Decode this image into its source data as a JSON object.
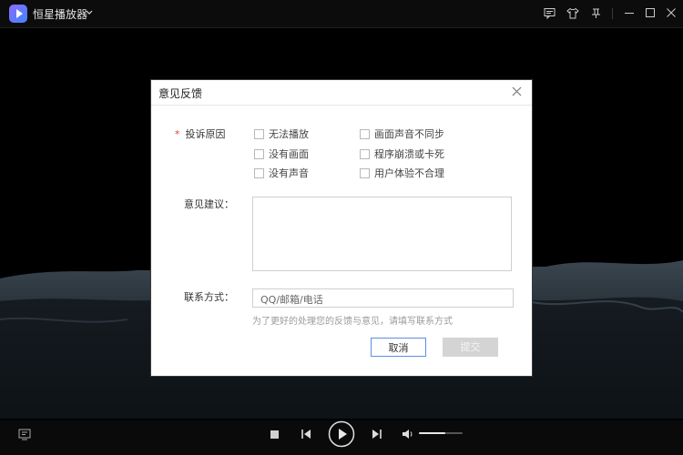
{
  "app": {
    "title": "恒星播放器"
  },
  "dialog": {
    "title": "意见反馈",
    "reason_label": "投诉原因",
    "required_mark": "*",
    "reasons": [
      {
        "label": "无法播放"
      },
      {
        "label": "画面声音不同步"
      },
      {
        "label": "没有画面"
      },
      {
        "label": "程序崩溃或卡死"
      },
      {
        "label": "没有声音"
      },
      {
        "label": "用户体验不合理"
      }
    ],
    "suggestion_label": "意见建议：",
    "contact_label": "联系方式：",
    "contact_placeholder": "QQ/邮箱/电话",
    "hint": "为了更好的处理您的反馈与意见，请填写联系方式",
    "cancel_label": "取消",
    "submit_label": "提交"
  },
  "player": {
    "volume": 0.6
  },
  "colors": {
    "accent": "#5a8fe0",
    "required": "#e23c3c",
    "brand": "#7a5cff"
  }
}
